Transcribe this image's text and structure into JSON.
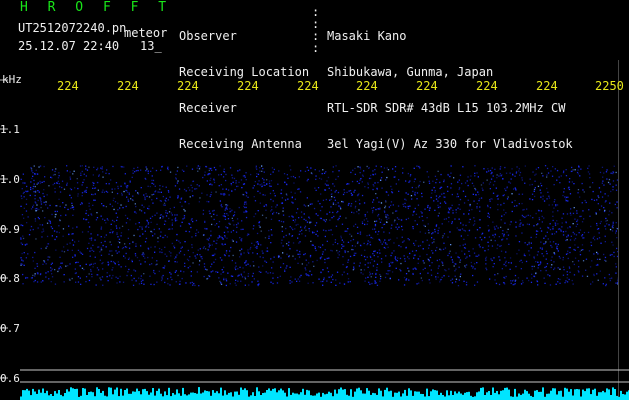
{
  "header": {
    "title": "H R O F F T",
    "filename": "UT2512072240.pn",
    "tag": "meteor",
    "datetime": "25.12.07 22:40",
    "count": "13_"
  },
  "station": {
    "labels": [
      "Observer",
      "Receiving Location",
      "Receiver",
      "Receiving Antenna"
    ],
    "values": [
      "Masaki Kano",
      "Shibukawa, Gunma, Japan",
      "RTL-SDR SDR# 43dB L15 103.2MHz CW",
      "3el Yagi(V) Az 330 for Vladivostok"
    ]
  },
  "axis": {
    "unit": "kHz",
    "y_ticks": [
      "1.1",
      "1.0",
      "0.9",
      "0.8",
      "0.7",
      "0.6"
    ],
    "x_ticks": [
      "224",
      "224",
      "224",
      "224",
      "224",
      "224",
      "224",
      "224",
      "224",
      "2250"
    ]
  },
  "colors": {
    "text_green": "#19e619",
    "text_white": "#f0f0f0",
    "text_yellow": "#e6e619",
    "signal_blue": "#1a2bff",
    "signal_bright": "#6aa0ff",
    "bottom_cyan": "#00e5ff"
  }
}
